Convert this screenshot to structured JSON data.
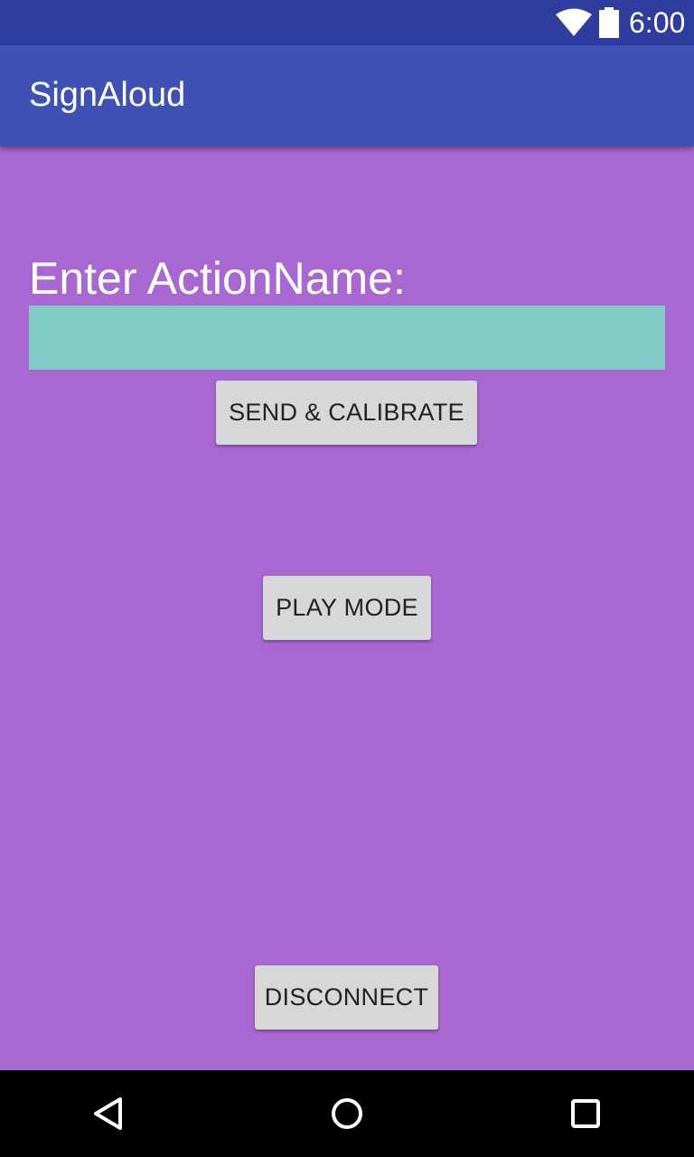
{
  "status_bar": {
    "time": "6:00",
    "icons": [
      "wifi-icon",
      "battery-icon"
    ]
  },
  "app_bar": {
    "title": "SignAloud"
  },
  "form": {
    "label": "Enter ActionName:",
    "input_value": "",
    "input_placeholder": ""
  },
  "buttons": {
    "send_calibrate": "SEND & CALIBRATE",
    "play_mode": "PLAY MODE",
    "disconnect": "DISCONNECT"
  },
  "nav_bar": {
    "icons": [
      "back-icon",
      "home-icon",
      "recents-icon"
    ]
  },
  "colors": {
    "status_bar": "#2e3d9e",
    "app_bar": "#3f51b5",
    "background": "#a967d1",
    "input_background": "#80cbc4",
    "button_background": "#d6d7d7",
    "nav_bar": "#000000"
  }
}
